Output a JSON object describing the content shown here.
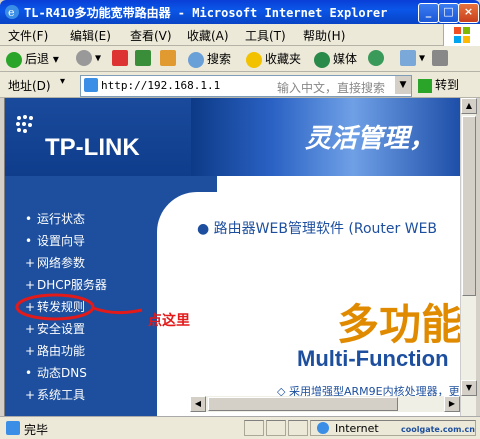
{
  "window": {
    "title": "TL-R410多功能宽带路由器 - Microsoft Internet Explorer",
    "buttons": [
      "_",
      "□",
      "×"
    ]
  },
  "menu": [
    "文件(F)",
    "编辑(E)",
    "查看(V)",
    "收藏(A)",
    "工具(T)",
    "帮助(H)"
  ],
  "toolbar": {
    "back": "后退",
    "search": "搜索",
    "favorites": "收藏夹",
    "media": "媒体"
  },
  "address": {
    "label": "地址(D)",
    "url": "http://192.168.1.1",
    "hint": "输入中文，直接搜索",
    "go": "转到"
  },
  "banner": {
    "logo": "TP-LINK",
    "slogan": "灵活管理，"
  },
  "sidebar": {
    "items": [
      "运行状态",
      "设置向导",
      "网络参数",
      "DHCP服务器",
      "转发规则",
      "安全设置",
      "路由功能",
      "动态DNS",
      "系统工具"
    ]
  },
  "main": {
    "heading": "路由器WEB管理软件 (Router WEB",
    "big_title": "多功能",
    "subtitle": "Multi-Function",
    "feature": "◇ 采用增强型ARM9E内核处理器，更"
  },
  "annotation": {
    "text": "点这里",
    "color": "#e21a1a"
  },
  "status": {
    "left": "完毕",
    "zone": "Internet",
    "watermark": "coolgate.com.cn"
  },
  "colors": {
    "brand_blue": "#1d4f9e",
    "accent_orange": "#e08a00"
  }
}
